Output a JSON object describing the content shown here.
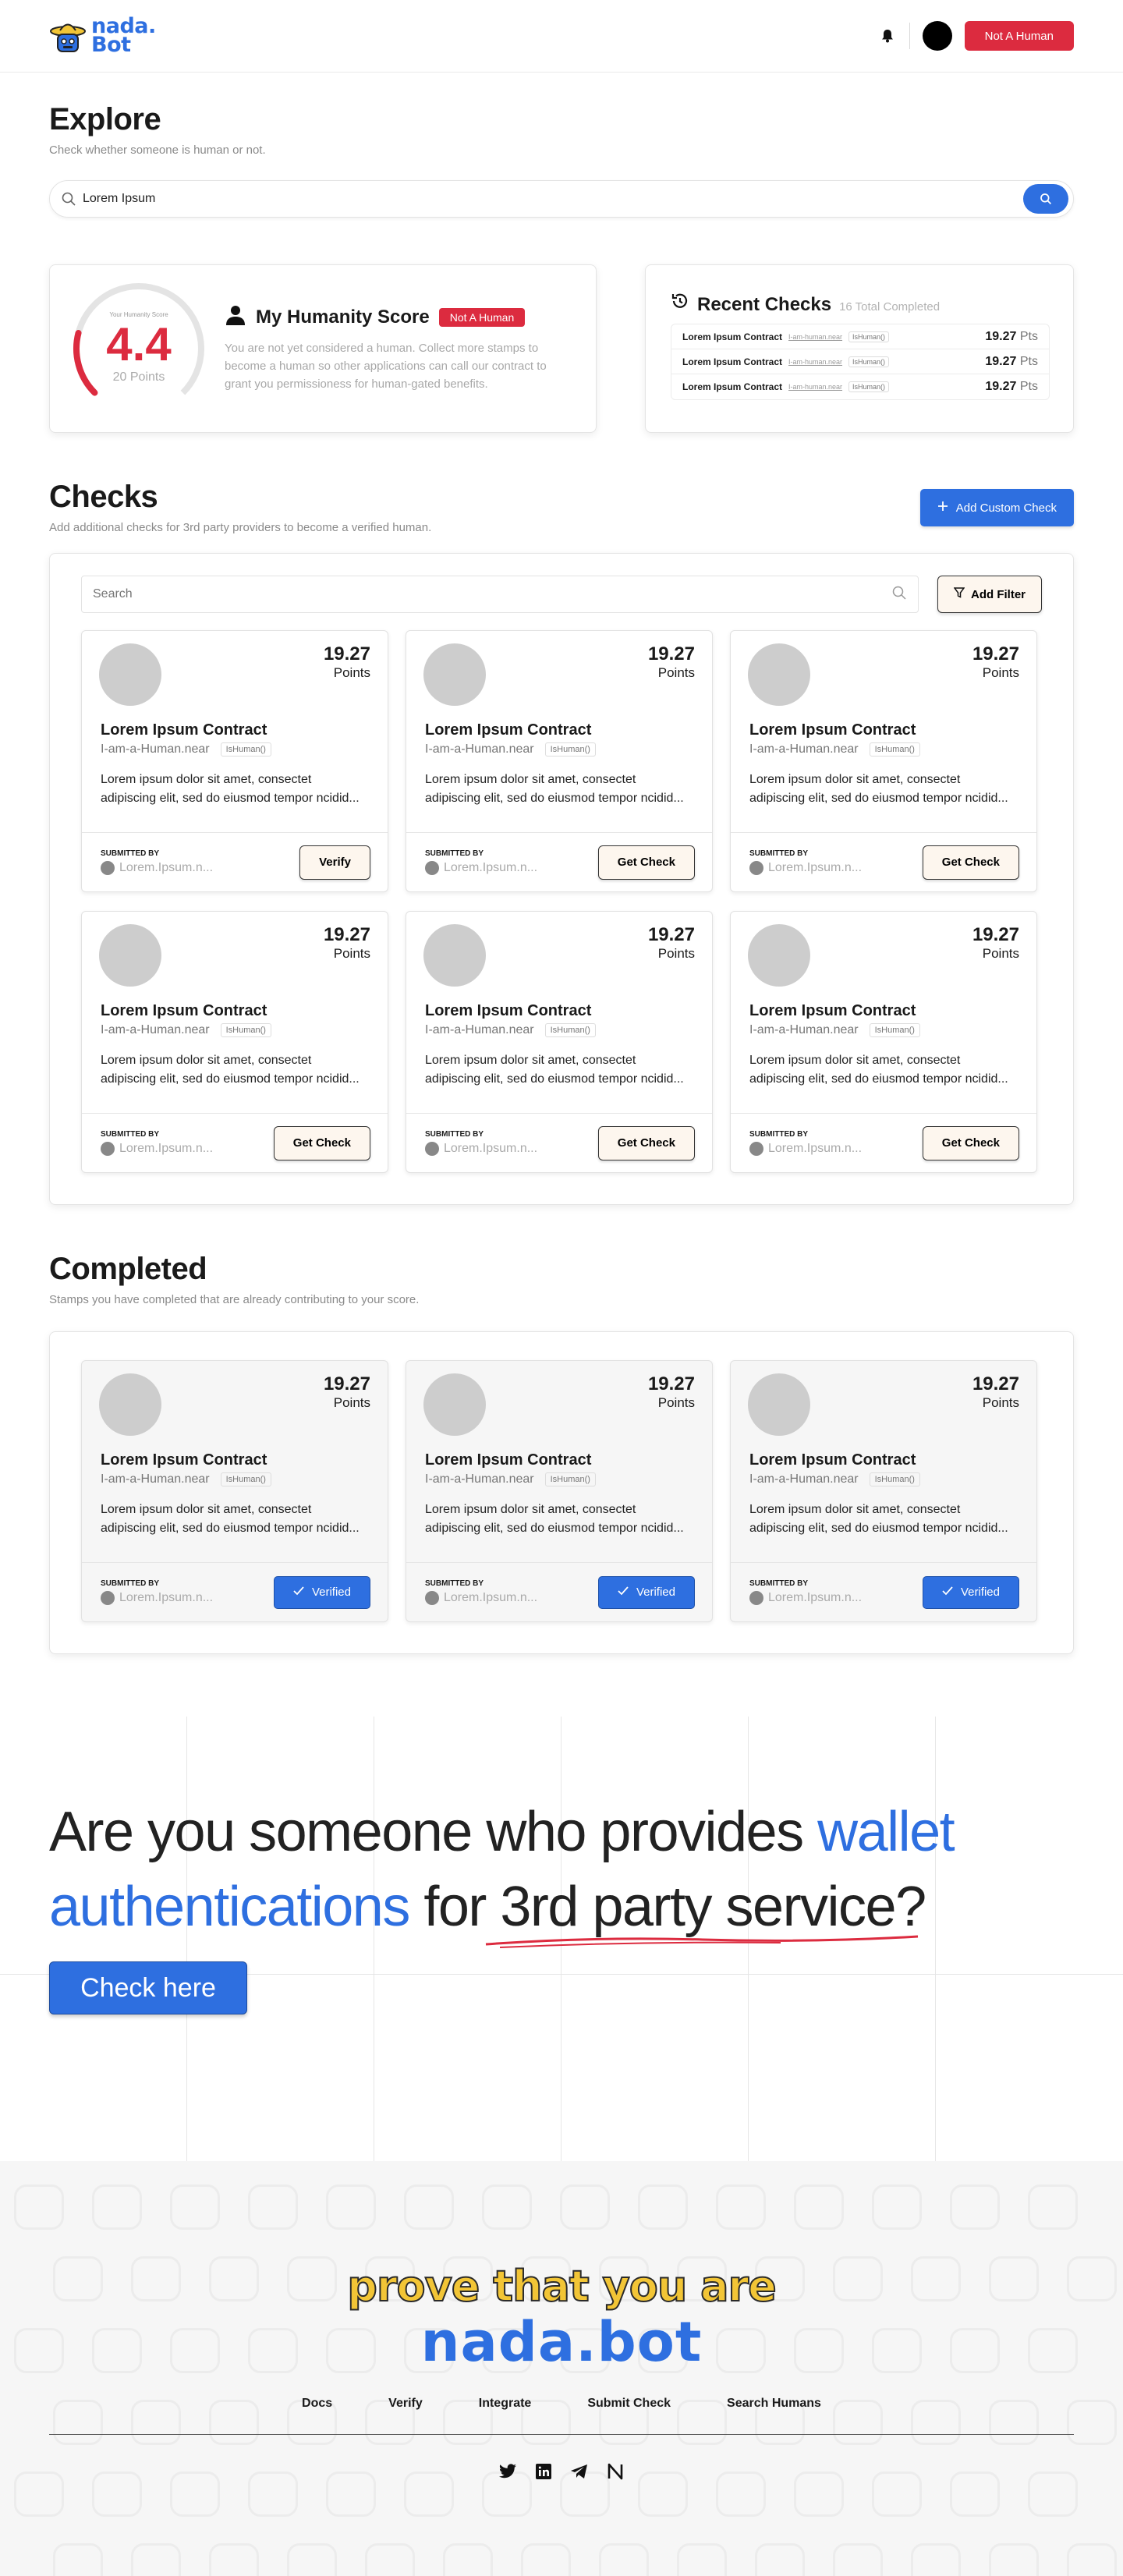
{
  "header": {
    "logo_line1": "nada.",
    "logo_line2": "Bot",
    "status_button": "Not A Human"
  },
  "explore": {
    "title": "Explore",
    "subtitle": "Check whether someone is human or not.",
    "search_value": "Lorem Ipsum"
  },
  "score": {
    "gauge_label": "Your Humanity Score",
    "value": "4.4",
    "points": "20 Points",
    "title": "My Humanity Score",
    "badge": "Not A Human",
    "text": "You are not yet considered a human. Collect more stamps to become a human so other applications can call our contract to grant you permissioness for human-gated benefits.",
    "level": 0.22
  },
  "recent": {
    "title": "Recent Checks",
    "count": "16 Total Completed",
    "items": [
      {
        "name": "Lorem Ipsum Contract",
        "near": "I-am-human.near",
        "fn": "IsHuman()",
        "pts": "19.27",
        "unit": "Pts"
      },
      {
        "name": "Lorem Ipsum Contract",
        "near": "I-am-human.near",
        "fn": "IsHuman()",
        "pts": "19.27",
        "unit": "Pts"
      },
      {
        "name": "Lorem Ipsum Contract",
        "near": "I-am-human.near",
        "fn": "IsHuman()",
        "pts": "19.27",
        "unit": "Pts"
      }
    ]
  },
  "checks": {
    "title": "Checks",
    "subtitle": "Add additional checks for 3rd party providers to become a verified human.",
    "add_button": "Add Custom Check",
    "search_placeholder": "Search",
    "filter_button": "Add Filter",
    "cards": [
      {
        "pts": "19.27",
        "pts_label": "Points",
        "name": "Lorem Ipsum Contract",
        "near": "I-am-a-Human.near",
        "fn": "IsHuman()",
        "desc": "Lorem ipsum dolor sit amet, consectet adipiscing elit, sed do eiusmod tempor ncidid...",
        "by_label": "SUBMITTED BY",
        "by": "Lorem.Ipsum.n...",
        "action": "Verify"
      },
      {
        "pts": "19.27",
        "pts_label": "Points",
        "name": "Lorem Ipsum Contract",
        "near": "I-am-a-Human.near",
        "fn": "IsHuman()",
        "desc": "Lorem ipsum dolor sit amet, consectet adipiscing elit, sed do eiusmod tempor ncidid...",
        "by_label": "SUBMITTED BY",
        "by": "Lorem.Ipsum.n...",
        "action": "Get Check"
      },
      {
        "pts": "19.27",
        "pts_label": "Points",
        "name": "Lorem Ipsum Contract",
        "near": "I-am-a-Human.near",
        "fn": "IsHuman()",
        "desc": "Lorem ipsum dolor sit amet, consectet adipiscing elit, sed do eiusmod tempor ncidid...",
        "by_label": "SUBMITTED BY",
        "by": "Lorem.Ipsum.n...",
        "action": "Get Check"
      },
      {
        "pts": "19.27",
        "pts_label": "Points",
        "name": "Lorem Ipsum Contract",
        "near": "I-am-a-Human.near",
        "fn": "IsHuman()",
        "desc": "Lorem ipsum dolor sit amet, consectet adipiscing elit, sed do eiusmod tempor ncidid...",
        "by_label": "SUBMITTED BY",
        "by": "Lorem.Ipsum.n...",
        "action": "Get Check"
      },
      {
        "pts": "19.27",
        "pts_label": "Points",
        "name": "Lorem Ipsum Contract",
        "near": "I-am-a-Human.near",
        "fn": "IsHuman()",
        "desc": "Lorem ipsum dolor sit amet, consectet adipiscing elit, sed do eiusmod tempor ncidid...",
        "by_label": "SUBMITTED BY",
        "by": "Lorem.Ipsum.n...",
        "action": "Get Check"
      },
      {
        "pts": "19.27",
        "pts_label": "Points",
        "name": "Lorem Ipsum Contract",
        "near": "I-am-a-Human.near",
        "fn": "IsHuman()",
        "desc": "Lorem ipsum dolor sit amet, consectet adipiscing elit, sed do eiusmod tempor ncidid...",
        "by_label": "SUBMITTED BY",
        "by": "Lorem.Ipsum.n...",
        "action": "Get Check"
      }
    ]
  },
  "completed": {
    "title": "Completed",
    "subtitle": "Stamps you have completed that are already contributing to your score.",
    "cards": [
      {
        "pts": "19.27",
        "pts_label": "Points",
        "name": "Lorem Ipsum Contract",
        "near": "I-am-a-Human.near",
        "fn": "IsHuman()",
        "desc": "Lorem ipsum dolor sit amet, consectet adipiscing elit, sed do eiusmod tempor ncidid...",
        "by_label": "SUBMITTED BY",
        "by": "Lorem.Ipsum.n...",
        "action": "Verified"
      },
      {
        "pts": "19.27",
        "pts_label": "Points",
        "name": "Lorem Ipsum Contract",
        "near": "I-am-a-Human.near",
        "fn": "IsHuman()",
        "desc": "Lorem ipsum dolor sit amet, consectet adipiscing elit, sed do eiusmod tempor ncidid...",
        "by_label": "SUBMITTED BY",
        "by": "Lorem.Ipsum.n...",
        "action": "Verified"
      },
      {
        "pts": "19.27",
        "pts_label": "Points",
        "name": "Lorem Ipsum Contract",
        "near": "I-am-a-Human.near",
        "fn": "IsHuman()",
        "desc": "Lorem ipsum dolor sit amet, consectet adipiscing elit, sed do eiusmod tempor ncidid...",
        "by_label": "SUBMITTED BY",
        "by": "Lorem.Ipsum.n...",
        "action": "Verified"
      }
    ]
  },
  "cta": {
    "part1": "Are you someone who provides ",
    "highlight1": "wallet authentications",
    "part2": " for ",
    "underlined": "3rd party service",
    "part3": "?",
    "button": "Check here"
  },
  "footer": {
    "tagline": "prove that you are",
    "brand": "nada.bot",
    "links": [
      "Docs",
      "Verify",
      "Integrate",
      "Submit Check",
      "Search Humans"
    ],
    "socials": [
      "twitter-icon",
      "linkedin-icon",
      "telegram-icon",
      "near-icon"
    ]
  },
  "colors": {
    "accent": "#2e6fe0",
    "danger": "#dc2b3f",
    "yellow": "#f2c536"
  }
}
